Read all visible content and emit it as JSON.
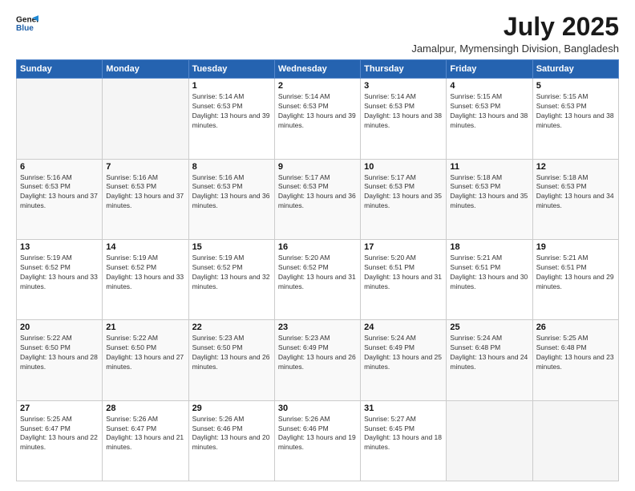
{
  "logo": {
    "line1": "General",
    "line2": "Blue"
  },
  "title": "July 2025",
  "subtitle": "Jamalpur, Mymensingh Division, Bangladesh",
  "days_header": [
    "Sunday",
    "Monday",
    "Tuesday",
    "Wednesday",
    "Thursday",
    "Friday",
    "Saturday"
  ],
  "weeks": [
    [
      {
        "day": "",
        "sunrise": "",
        "sunset": "",
        "daylight": ""
      },
      {
        "day": "",
        "sunrise": "",
        "sunset": "",
        "daylight": ""
      },
      {
        "day": "1",
        "sunrise": "Sunrise: 5:14 AM",
        "sunset": "Sunset: 6:53 PM",
        "daylight": "Daylight: 13 hours and 39 minutes."
      },
      {
        "day": "2",
        "sunrise": "Sunrise: 5:14 AM",
        "sunset": "Sunset: 6:53 PM",
        "daylight": "Daylight: 13 hours and 39 minutes."
      },
      {
        "day": "3",
        "sunrise": "Sunrise: 5:14 AM",
        "sunset": "Sunset: 6:53 PM",
        "daylight": "Daylight: 13 hours and 38 minutes."
      },
      {
        "day": "4",
        "sunrise": "Sunrise: 5:15 AM",
        "sunset": "Sunset: 6:53 PM",
        "daylight": "Daylight: 13 hours and 38 minutes."
      },
      {
        "day": "5",
        "sunrise": "Sunrise: 5:15 AM",
        "sunset": "Sunset: 6:53 PM",
        "daylight": "Daylight: 13 hours and 38 minutes."
      }
    ],
    [
      {
        "day": "6",
        "sunrise": "Sunrise: 5:16 AM",
        "sunset": "Sunset: 6:53 PM",
        "daylight": "Daylight: 13 hours and 37 minutes."
      },
      {
        "day": "7",
        "sunrise": "Sunrise: 5:16 AM",
        "sunset": "Sunset: 6:53 PM",
        "daylight": "Daylight: 13 hours and 37 minutes."
      },
      {
        "day": "8",
        "sunrise": "Sunrise: 5:16 AM",
        "sunset": "Sunset: 6:53 PM",
        "daylight": "Daylight: 13 hours and 36 minutes."
      },
      {
        "day": "9",
        "sunrise": "Sunrise: 5:17 AM",
        "sunset": "Sunset: 6:53 PM",
        "daylight": "Daylight: 13 hours and 36 minutes."
      },
      {
        "day": "10",
        "sunrise": "Sunrise: 5:17 AM",
        "sunset": "Sunset: 6:53 PM",
        "daylight": "Daylight: 13 hours and 35 minutes."
      },
      {
        "day": "11",
        "sunrise": "Sunrise: 5:18 AM",
        "sunset": "Sunset: 6:53 PM",
        "daylight": "Daylight: 13 hours and 35 minutes."
      },
      {
        "day": "12",
        "sunrise": "Sunrise: 5:18 AM",
        "sunset": "Sunset: 6:53 PM",
        "daylight": "Daylight: 13 hours and 34 minutes."
      }
    ],
    [
      {
        "day": "13",
        "sunrise": "Sunrise: 5:19 AM",
        "sunset": "Sunset: 6:52 PM",
        "daylight": "Daylight: 13 hours and 33 minutes."
      },
      {
        "day": "14",
        "sunrise": "Sunrise: 5:19 AM",
        "sunset": "Sunset: 6:52 PM",
        "daylight": "Daylight: 13 hours and 33 minutes."
      },
      {
        "day": "15",
        "sunrise": "Sunrise: 5:19 AM",
        "sunset": "Sunset: 6:52 PM",
        "daylight": "Daylight: 13 hours and 32 minutes."
      },
      {
        "day": "16",
        "sunrise": "Sunrise: 5:20 AM",
        "sunset": "Sunset: 6:52 PM",
        "daylight": "Daylight: 13 hours and 31 minutes."
      },
      {
        "day": "17",
        "sunrise": "Sunrise: 5:20 AM",
        "sunset": "Sunset: 6:51 PM",
        "daylight": "Daylight: 13 hours and 31 minutes."
      },
      {
        "day": "18",
        "sunrise": "Sunrise: 5:21 AM",
        "sunset": "Sunset: 6:51 PM",
        "daylight": "Daylight: 13 hours and 30 minutes."
      },
      {
        "day": "19",
        "sunrise": "Sunrise: 5:21 AM",
        "sunset": "Sunset: 6:51 PM",
        "daylight": "Daylight: 13 hours and 29 minutes."
      }
    ],
    [
      {
        "day": "20",
        "sunrise": "Sunrise: 5:22 AM",
        "sunset": "Sunset: 6:50 PM",
        "daylight": "Daylight: 13 hours and 28 minutes."
      },
      {
        "day": "21",
        "sunrise": "Sunrise: 5:22 AM",
        "sunset": "Sunset: 6:50 PM",
        "daylight": "Daylight: 13 hours and 27 minutes."
      },
      {
        "day": "22",
        "sunrise": "Sunrise: 5:23 AM",
        "sunset": "Sunset: 6:50 PM",
        "daylight": "Daylight: 13 hours and 26 minutes."
      },
      {
        "day": "23",
        "sunrise": "Sunrise: 5:23 AM",
        "sunset": "Sunset: 6:49 PM",
        "daylight": "Daylight: 13 hours and 26 minutes."
      },
      {
        "day": "24",
        "sunrise": "Sunrise: 5:24 AM",
        "sunset": "Sunset: 6:49 PM",
        "daylight": "Daylight: 13 hours and 25 minutes."
      },
      {
        "day": "25",
        "sunrise": "Sunrise: 5:24 AM",
        "sunset": "Sunset: 6:48 PM",
        "daylight": "Daylight: 13 hours and 24 minutes."
      },
      {
        "day": "26",
        "sunrise": "Sunrise: 5:25 AM",
        "sunset": "Sunset: 6:48 PM",
        "daylight": "Daylight: 13 hours and 23 minutes."
      }
    ],
    [
      {
        "day": "27",
        "sunrise": "Sunrise: 5:25 AM",
        "sunset": "Sunset: 6:47 PM",
        "daylight": "Daylight: 13 hours and 22 minutes."
      },
      {
        "day": "28",
        "sunrise": "Sunrise: 5:26 AM",
        "sunset": "Sunset: 6:47 PM",
        "daylight": "Daylight: 13 hours and 21 minutes."
      },
      {
        "day": "29",
        "sunrise": "Sunrise: 5:26 AM",
        "sunset": "Sunset: 6:46 PM",
        "daylight": "Daylight: 13 hours and 20 minutes."
      },
      {
        "day": "30",
        "sunrise": "Sunrise: 5:26 AM",
        "sunset": "Sunset: 6:46 PM",
        "daylight": "Daylight: 13 hours and 19 minutes."
      },
      {
        "day": "31",
        "sunrise": "Sunrise: 5:27 AM",
        "sunset": "Sunset: 6:45 PM",
        "daylight": "Daylight: 13 hours and 18 minutes."
      },
      {
        "day": "",
        "sunrise": "",
        "sunset": "",
        "daylight": ""
      },
      {
        "day": "",
        "sunrise": "",
        "sunset": "",
        "daylight": ""
      }
    ]
  ]
}
